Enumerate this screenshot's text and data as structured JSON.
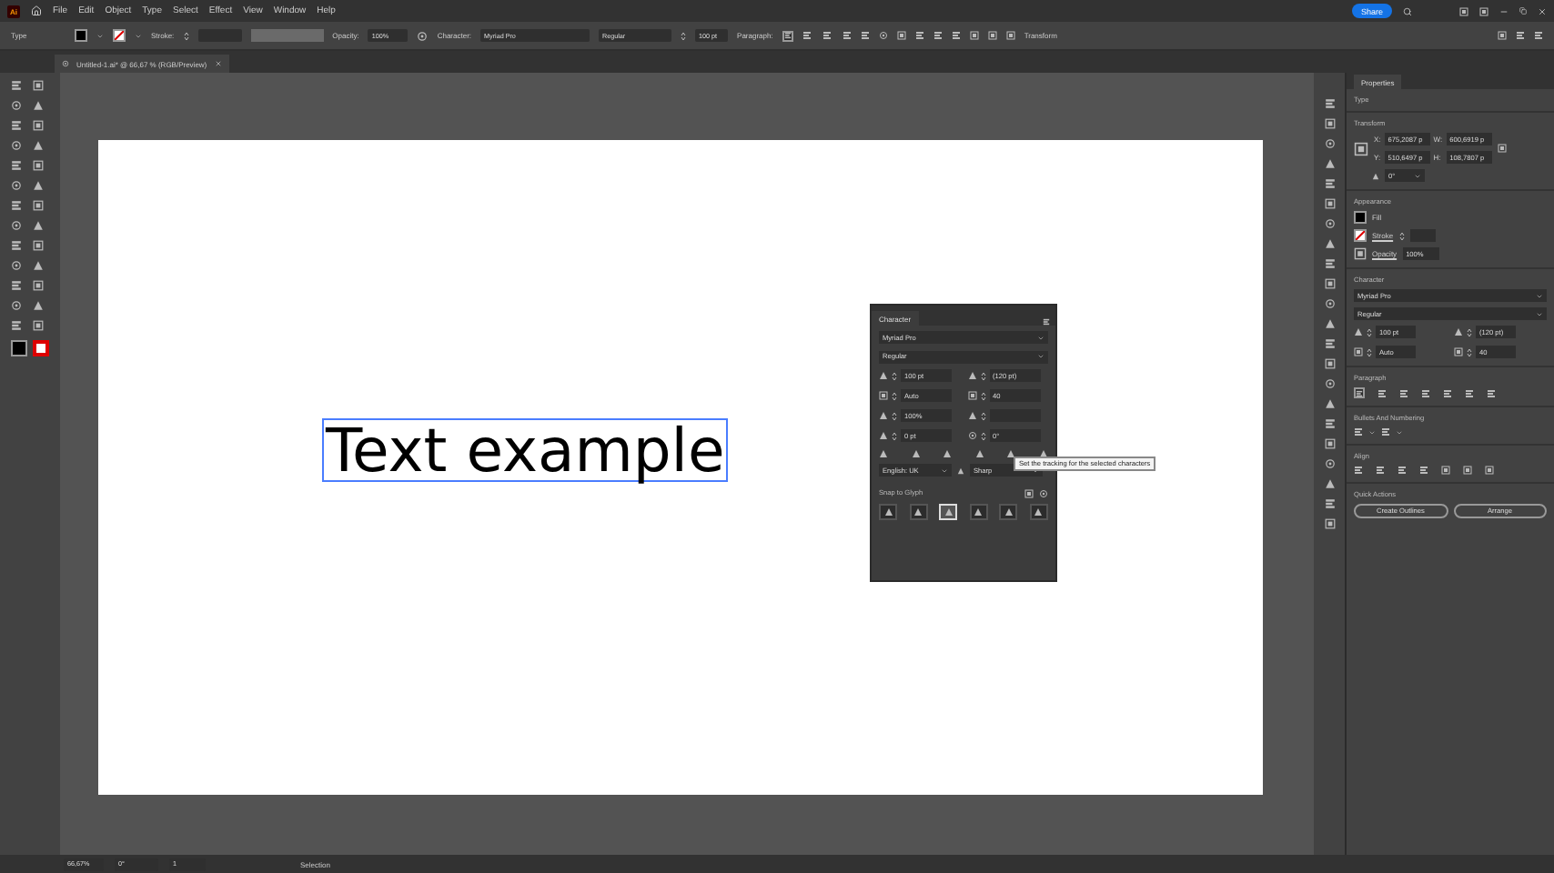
{
  "menu_bar": {
    "logo": "Ai",
    "menus": [
      "File",
      "Edit",
      "Object",
      "Type",
      "Select",
      "Effect",
      "View",
      "Window",
      "Help"
    ],
    "share": "Share"
  },
  "control_bar": {
    "mode": "Type",
    "stroke_label": "Stroke:",
    "opacity_label": "Opacity:",
    "opacity": "100%",
    "character_label": "Character:",
    "font": "Myriad Pro",
    "style": "Regular",
    "size": "100 pt",
    "paragraph_label": "Paragraph:",
    "align": [
      {
        "selected": true
      },
      {
        "selected": false
      },
      {
        "selected": false
      }
    ],
    "transform": "Transform"
  },
  "document_tab": {
    "title": "Untitled-1.ai* @ 66,67 % (RGB/Preview)"
  },
  "canvas": {
    "text": "Text example"
  },
  "character_panel": {
    "title": "Character",
    "font": "Myriad Pro",
    "style": "Regular",
    "size": "100 pt",
    "leading": "(120 pt)",
    "kerning": "Auto",
    "tracking": "40",
    "vertical_scale": "100%",
    "baseline_shift": "0 pt",
    "rotation": "0°",
    "language": "English: UK",
    "antialiasing": "Sharp",
    "snap_label": "Snap to Glyph",
    "glyph_buttons": [
      {
        "selected": false
      },
      {
        "selected": false
      },
      {
        "selected": true
      },
      {
        "selected": false
      },
      {
        "selected": false
      },
      {
        "selected": false
      }
    ],
    "tooltip": "Set the tracking for the selected characters"
  },
  "properties": {
    "tab": "Properties",
    "type": "Type",
    "transform_title": "Transform",
    "x_label": "X:",
    "x": "675,2087 p",
    "w_label": "W:",
    "w": "600,6919 p",
    "y_label": "Y:",
    "y": "510,6497 p",
    "h_label": "H:",
    "h": "108,7807 p",
    "angle": "0°",
    "appearance_title": "Appearance",
    "fill": "Fill",
    "stroke": "Stroke",
    "opacity_label": "Opacity",
    "opacity": "100%",
    "character_title": "Character",
    "font": "Myriad Pro",
    "style": "Regular",
    "size": "100 pt",
    "leading": "(120 pt)",
    "kerning": "Auto",
    "tracking": "40",
    "paragraph_title": "Paragraph",
    "paragraph_align": [
      {
        "selected": true
      },
      {
        "selected": false
      },
      {
        "selected": false
      },
      {
        "selected": false
      },
      {
        "selected": false
      },
      {
        "selected": false
      },
      {
        "selected": false
      }
    ],
    "bullets_title": "Bullets And Numbering",
    "align_title": "Align",
    "quick_actions_title": "Quick Actions",
    "create_outlines": "Create Outlines",
    "arrange": "Arrange"
  },
  "status_bar": {
    "zoom": "66,67%",
    "rotation": "0°",
    "artboard": "1",
    "tool": "Selection"
  }
}
